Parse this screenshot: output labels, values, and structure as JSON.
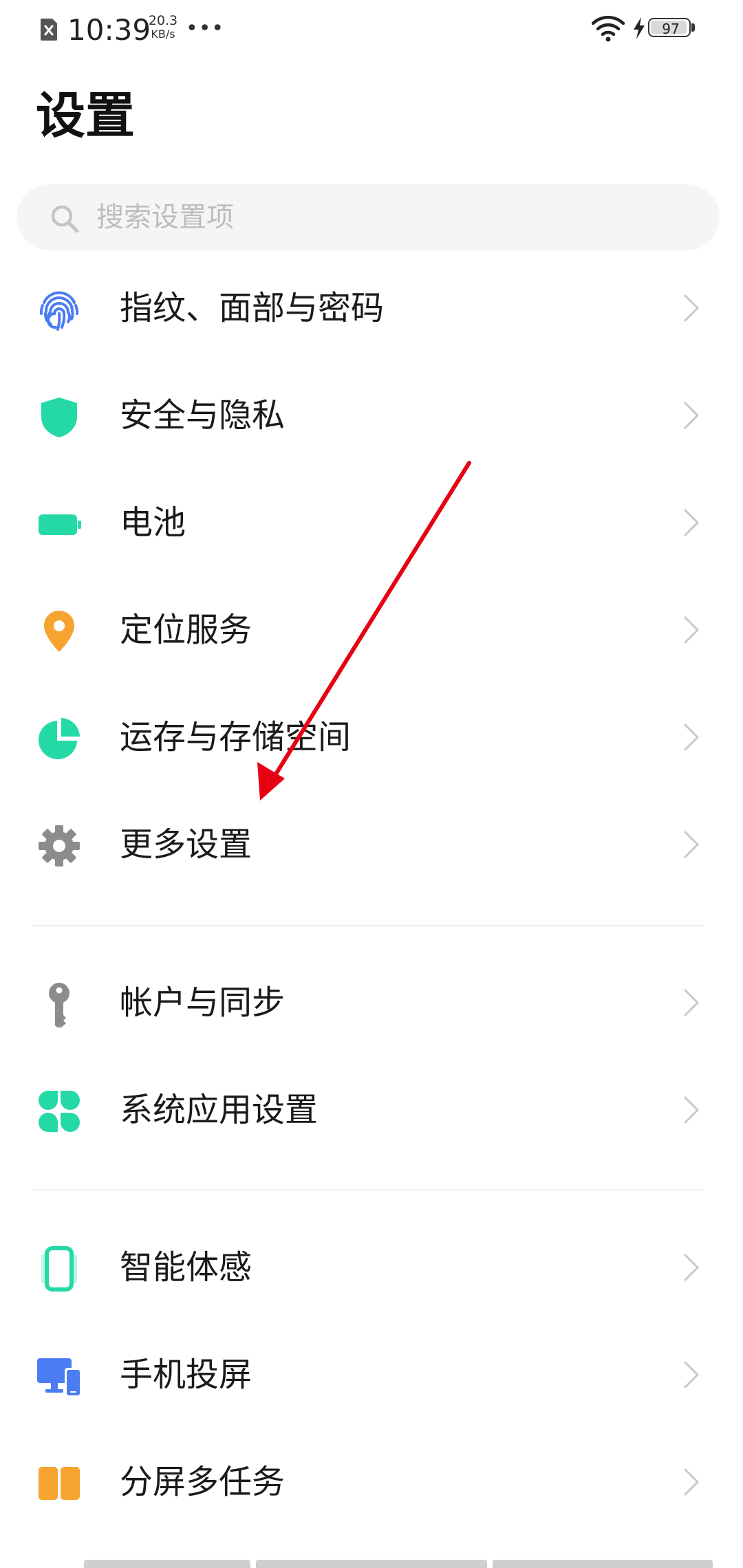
{
  "status_bar": {
    "time": "10:39",
    "speed_value": "20.3",
    "speed_unit": "KB/s",
    "more": "•••",
    "battery_level": "97",
    "sim_icon": "sim-error-icon",
    "wifi_icon": "wifi-icon",
    "charging_icon": "charging-bolt-icon"
  },
  "page": {
    "title": "设置"
  },
  "search": {
    "placeholder": "搜索设置项",
    "value": ""
  },
  "colors": {
    "accent_green": "#25d9a6",
    "accent_blue": "#4a7cf3",
    "accent_orange": "#f7a330",
    "gray_icon": "#8c8c8c",
    "annotation_red": "#e60012"
  },
  "groups": [
    {
      "items": [
        {
          "label": "指纹、面部与密码",
          "icon": "fingerprint-icon"
        },
        {
          "label": "安全与隐私",
          "icon": "shield-icon"
        },
        {
          "label": "电池",
          "icon": "battery-icon"
        },
        {
          "label": "定位服务",
          "icon": "location-pin-icon"
        },
        {
          "label": "运存与存储空间",
          "icon": "storage-pie-icon"
        },
        {
          "label": "更多设置",
          "icon": "gear-icon"
        }
      ]
    },
    {
      "items": [
        {
          "label": "帐户与同步",
          "icon": "key-icon"
        },
        {
          "label": "系统应用设置",
          "icon": "apps-grid-icon"
        }
      ]
    },
    {
      "items": [
        {
          "label": "智能体感",
          "icon": "phone-motion-icon"
        },
        {
          "label": "手机投屏",
          "icon": "screen-cast-icon"
        },
        {
          "label": "分屏多任务",
          "icon": "split-screen-icon"
        }
      ]
    }
  ]
}
